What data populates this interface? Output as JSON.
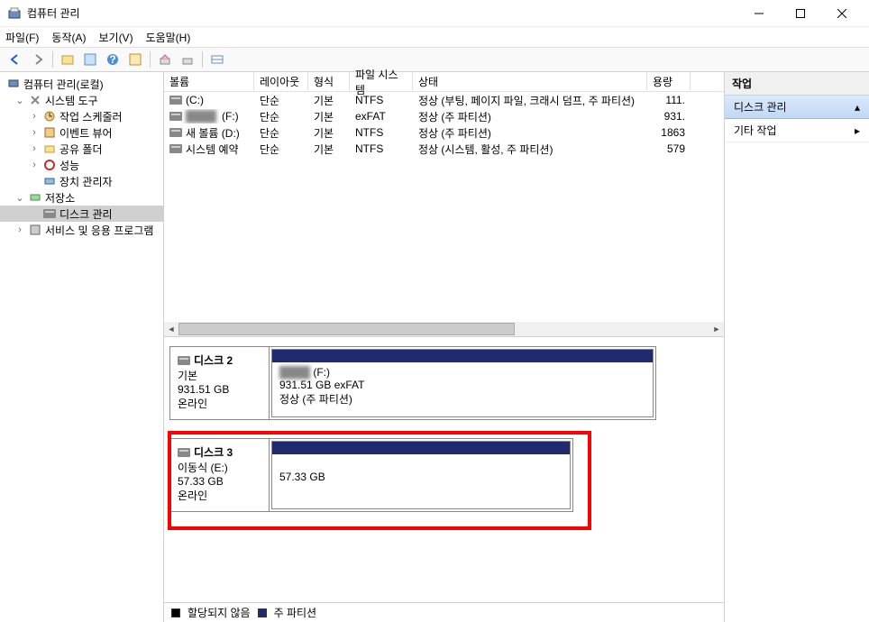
{
  "window": {
    "title": "컴퓨터 관리"
  },
  "menubar": [
    "파일(F)",
    "동작(A)",
    "보기(V)",
    "도움말(H)"
  ],
  "tree": {
    "root": "컴퓨터 관리(로컬)",
    "system_tools": "시스템 도구",
    "task_scheduler": "작업 스케줄러",
    "event_viewer": "이벤트 뷰어",
    "shared_folders": "공유 폴더",
    "performance": "성능",
    "device_manager": "장치 관리자",
    "storage": "저장소",
    "disk_mgmt": "디스크 관리",
    "services": "서비스 및 응용 프로그램"
  },
  "columns": {
    "volume": "볼륨",
    "layout": "레이아웃",
    "type": "형식",
    "fs": "파일 시스템",
    "status": "상태",
    "capacity": "용량"
  },
  "volumes": [
    {
      "name": "(C:)",
      "layout": "단순",
      "type": "기본",
      "fs": "NTFS",
      "status": "정상 (부팅, 페이지 파일, 크래시 덤프, 주 파티션)",
      "cap": "111."
    },
    {
      "name": "(F:)",
      "blurred": true,
      "layout": "단순",
      "type": "기본",
      "fs": "exFAT",
      "status": "정상 (주 파티션)",
      "cap": "931."
    },
    {
      "name": "새 볼륨 (D:)",
      "layout": "단순",
      "type": "기본",
      "fs": "NTFS",
      "status": "정상 (주 파티션)",
      "cap": "1863"
    },
    {
      "name": "시스템 예약",
      "layout": "단순",
      "type": "기본",
      "fs": "NTFS",
      "status": "정상 (시스템, 활성, 주 파티션)",
      "cap": "579"
    }
  ],
  "disks": {
    "disk2": {
      "title": "디스크 2",
      "type": "기본",
      "size": "931.51 GB",
      "status": "온라인",
      "partition": {
        "label": "(F:)",
        "size_fs": "931.51 GB exFAT",
        "pstatus": "정상 (주 파티션)"
      }
    },
    "disk3": {
      "title": "디스크 3",
      "type": "이동식 (E:)",
      "size": "57.33 GB",
      "status": "온라인",
      "partition": {
        "size": "57.33 GB"
      }
    }
  },
  "legend": {
    "unalloc": "할당되지 않음",
    "primary": "주 파티션"
  },
  "actions": {
    "header": "작업",
    "disk_mgmt": "디스크 관리",
    "other": "기타 작업"
  }
}
